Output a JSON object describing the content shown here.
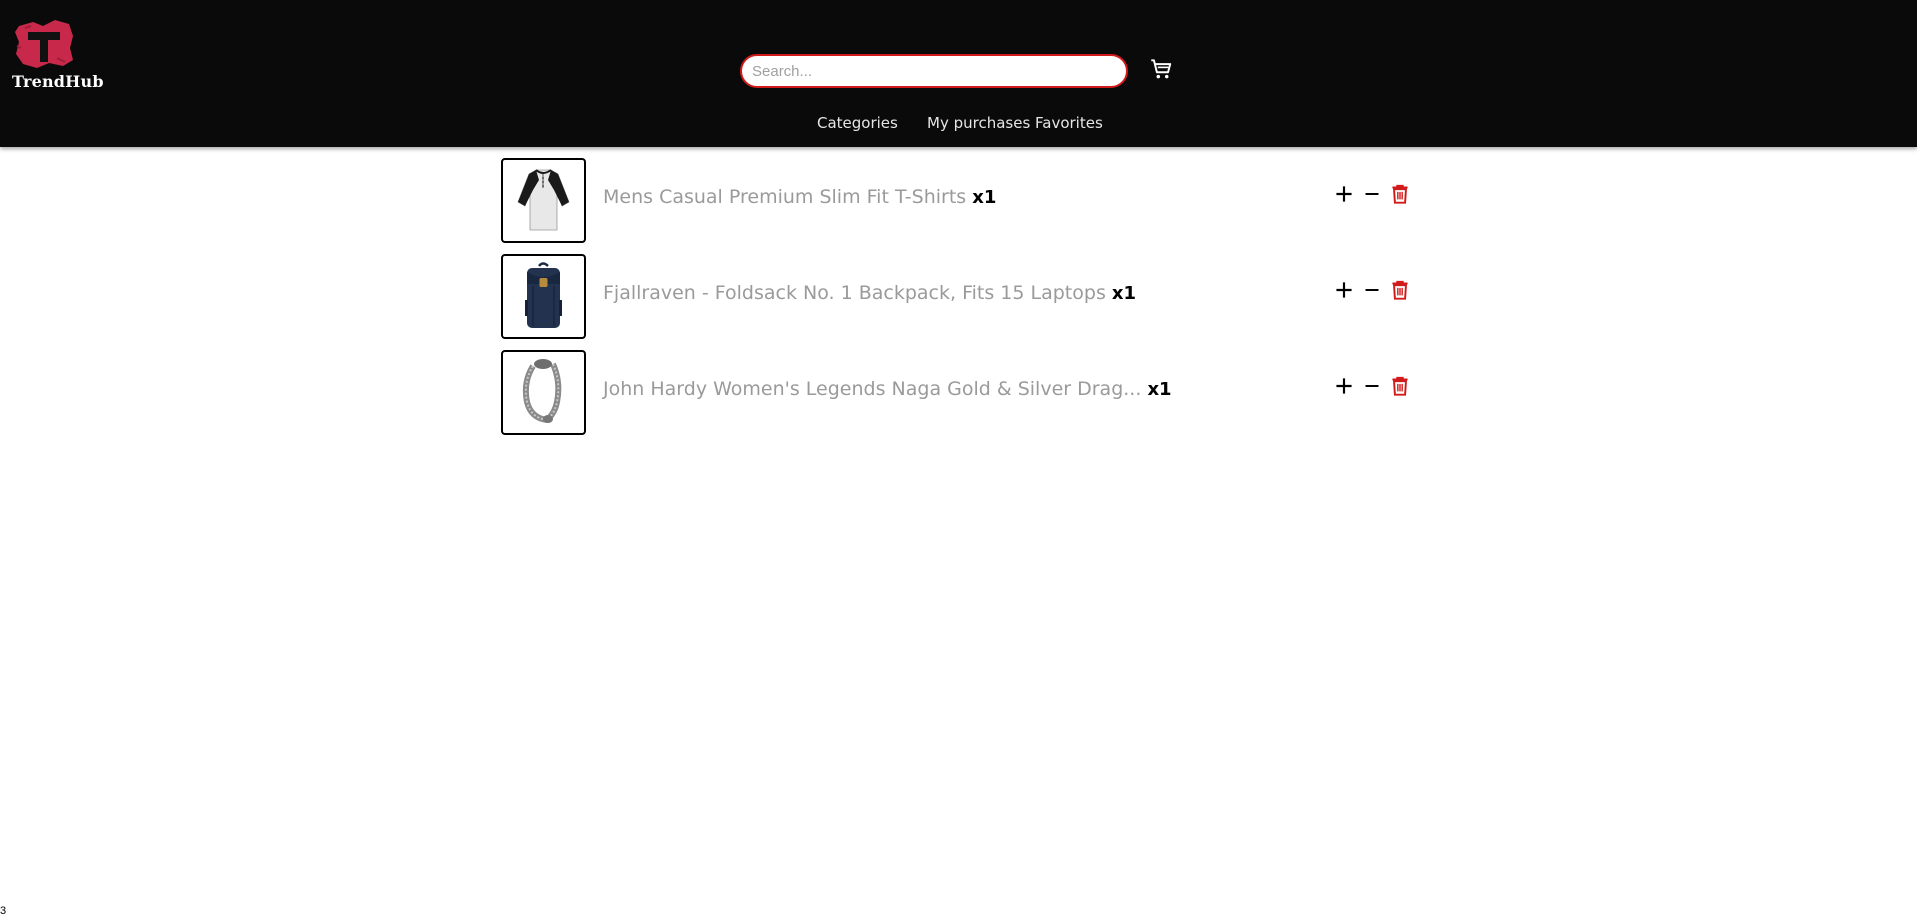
{
  "app": {
    "brand": "TrendHub",
    "brand_color": "#c8294a",
    "accent_color": "#d11a1a"
  },
  "header": {
    "search_placeholder": "Search...",
    "search_value": "",
    "cart_icon": "shopping-cart-icon",
    "nav": {
      "categories": "Categories",
      "purchases": "My purchases",
      "favorites": "Favorites"
    }
  },
  "cart": {
    "items": [
      {
        "title": "Mens Casual Premium Slim Fit T-Shirts",
        "qty": "x1",
        "image_icon": "tshirt-image"
      },
      {
        "title": "Fjallraven - Foldsack No. 1 Backpack, Fits 15 Laptops",
        "qty": "x1",
        "image_icon": "backpack-image"
      },
      {
        "title": "John Hardy Women's Legends Naga Gold & Silver Drag...",
        "qty": "x1",
        "image_icon": "bracelet-image"
      }
    ],
    "actions": {
      "add_icon": "plus-icon",
      "remove_icon": "minus-icon",
      "delete_icon": "trash-icon"
    }
  },
  "footer": {
    "page_number": "3"
  }
}
